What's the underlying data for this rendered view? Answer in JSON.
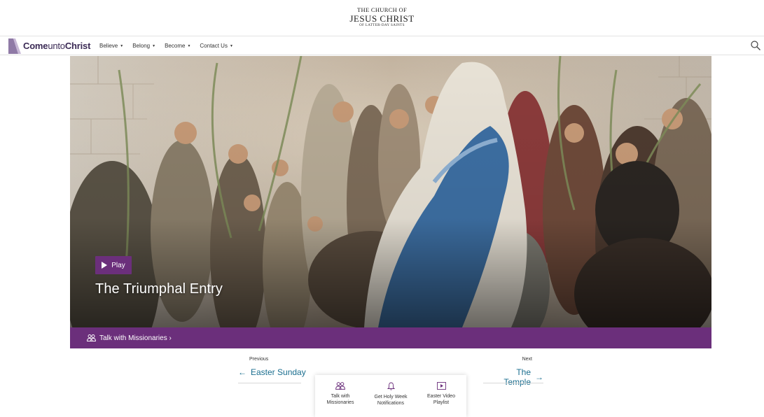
{
  "church_logo": {
    "line1": "THE CHURCH OF",
    "line2": "JESUS CHRIST",
    "line3": "OF LATTER-DAY SAINTS"
  },
  "nav": {
    "brand_bold1": "Come",
    "brand_mid": "unto",
    "brand_bold2": "Christ",
    "items": [
      {
        "label": "Believe"
      },
      {
        "label": "Belong"
      },
      {
        "label": "Become"
      },
      {
        "label": "Contact Us"
      }
    ],
    "search_icon": "search-icon"
  },
  "hero": {
    "play_label": "Play",
    "title": "The Triumphal Entry"
  },
  "mission_bar": {
    "label": "Talk with Missionaries ›"
  },
  "pagination": {
    "prev_small": "Previous",
    "prev_title": "Easter Sunday",
    "next_small": "Next",
    "next_title": "The Temple"
  },
  "actions": [
    {
      "icon": "people-icon",
      "line1": "Talk with",
      "line2": "Missionaries"
    },
    {
      "icon": "bell-icon",
      "line1": "Get Holy Week",
      "line2": "Notifications"
    },
    {
      "icon": "video-icon",
      "line1": "Easter Video",
      "line2": "Playlist"
    }
  ],
  "colors": {
    "accent_purple": "#6b2f7b",
    "link_blue": "#1a6e8f",
    "brand_dark": "#3b2a55"
  }
}
